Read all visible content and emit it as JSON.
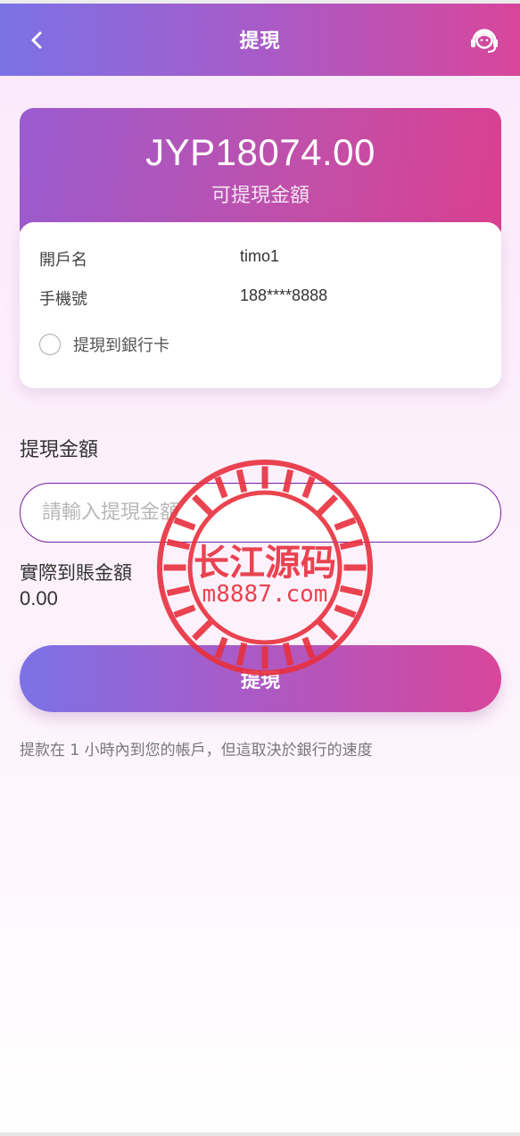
{
  "header": {
    "title": "提現"
  },
  "balance": {
    "amount": "JYP18074.00",
    "label": "可提現金額"
  },
  "account": {
    "name_label": "開戶名",
    "name_value": "timo1",
    "phone_label": "手機號",
    "phone_value": "188****8888",
    "withdraw_to_bank": "提現到銀行卡"
  },
  "form": {
    "section_title": "提現金額",
    "amount_placeholder": "請輸入提現金額",
    "actual_label": "實際到賬金額",
    "actual_value": "0.00",
    "submit_label": "提現"
  },
  "note": "提款在 1 小時內到您的帳戶，但這取決於銀行的速度",
  "watermark": {
    "title": "长江源码",
    "url": "m8887.com",
    "color": "#e8303e"
  },
  "colors": {
    "gradient_start": "#7b72e6",
    "gradient_end": "#d8469a",
    "input_border": "#7a1fa0"
  }
}
